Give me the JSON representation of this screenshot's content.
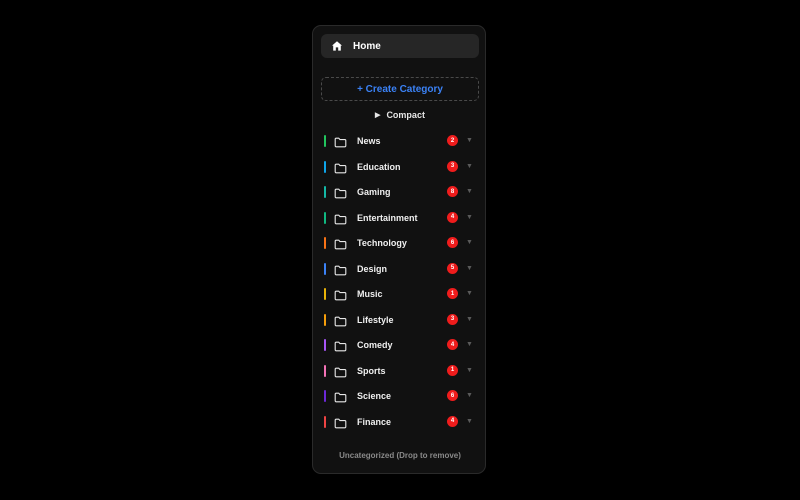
{
  "sidebar": {
    "home": {
      "label": "Home",
      "icon": "home-icon"
    },
    "create_label": "+ Create Category",
    "compact": {
      "label": "Compact",
      "icon": "triangle-right-icon"
    },
    "categories": [
      {
        "name": "News",
        "count": "2",
        "color": "#22c55e"
      },
      {
        "name": "Education",
        "count": "3",
        "color": "#0ea5e9"
      },
      {
        "name": "Gaming",
        "count": "8",
        "color": "#14b8a6"
      },
      {
        "name": "Entertainment",
        "count": "4",
        "color": "#10b981"
      },
      {
        "name": "Technology",
        "count": "6",
        "color": "#f97316"
      },
      {
        "name": "Design",
        "count": "5",
        "color": "#3b82f6"
      },
      {
        "name": "Music",
        "count": "1",
        "color": "#eab308"
      },
      {
        "name": "Lifestyle",
        "count": "3",
        "color": "#f59e0b"
      },
      {
        "name": "Comedy",
        "count": "4",
        "color": "#a855f7"
      },
      {
        "name": "Sports",
        "count": "1",
        "color": "#f472b6"
      },
      {
        "name": "Science",
        "count": "6",
        "color": "#6d28d9"
      },
      {
        "name": "Finance",
        "count": "4",
        "color": "#ef4444"
      }
    ],
    "footer": "Uncategorized (Drop to remove)",
    "colors": {
      "accent": "#3b82f6",
      "badge": "#ef1c1c",
      "panel_bg": "#111111",
      "page_bg": "#000000"
    },
    "icons": {
      "folder": "folder-icon",
      "expand": "chevron-down-icon"
    }
  }
}
